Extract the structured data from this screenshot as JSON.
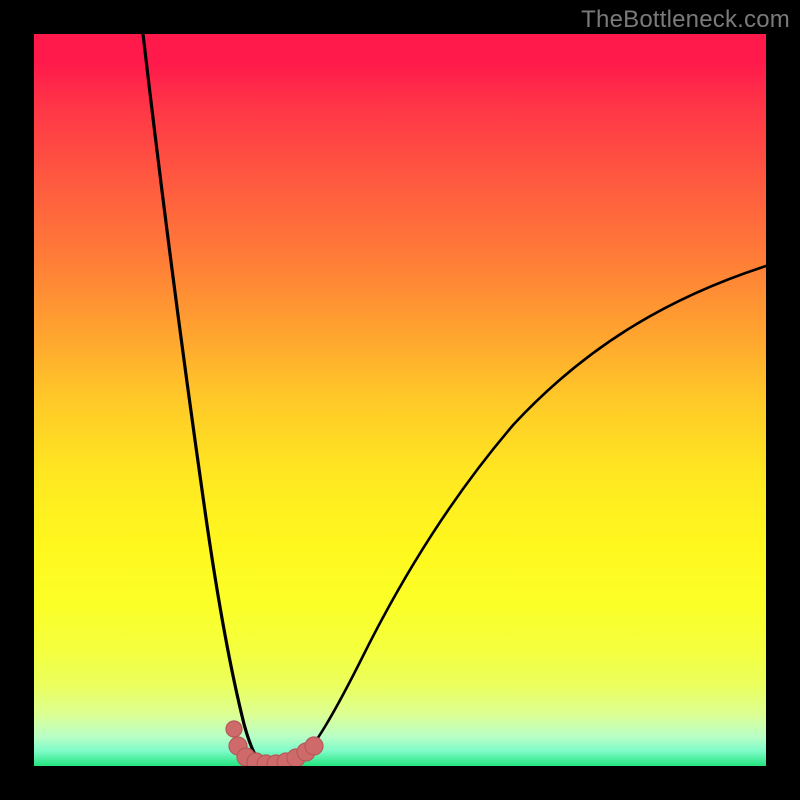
{
  "watermark": "TheBottleneck.com",
  "colors": {
    "frame": "#000000",
    "curve": "#000000",
    "marker_fill": "#cf6a6a",
    "marker_stroke": "#b75858"
  },
  "chart_data": {
    "type": "line",
    "title": "",
    "xlabel": "",
    "ylabel": "",
    "xlim": [
      0,
      100
    ],
    "ylim": [
      0,
      100
    ],
    "grid": false,
    "legend": false,
    "series": [
      {
        "name": "left-curve",
        "x": [
          15,
          18,
          20,
          22,
          24,
          26,
          27.3,
          28,
          29,
          30
        ],
        "y": [
          100,
          70,
          53,
          38,
          25,
          13,
          5,
          3,
          1,
          0
        ]
      },
      {
        "name": "right-curve",
        "x": [
          36,
          40,
          45,
          50,
          55,
          60,
          65,
          70,
          75,
          80,
          85,
          90,
          95,
          100
        ],
        "y": [
          0,
          4,
          12,
          20,
          28,
          35,
          41,
          47,
          52,
          56,
          60,
          63,
          66,
          68
        ]
      },
      {
        "name": "valley-markers",
        "x": [
          27.3,
          28.0,
          29.0,
          30.0,
          31.0,
          32.0,
          33.0,
          34.0,
          35.0,
          36.0
        ],
        "y": [
          5.0,
          2.4,
          1.2,
          0.7,
          0.5,
          0.5,
          0.7,
          1.0,
          1.6,
          2.4
        ]
      }
    ]
  }
}
